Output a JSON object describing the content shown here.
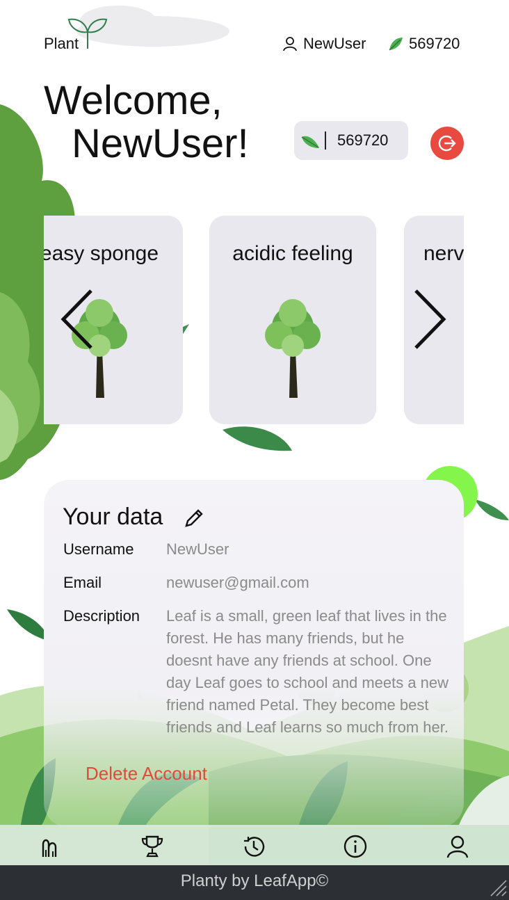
{
  "header": {
    "logo_text": "Plant",
    "username": "NewUser",
    "points": "569720"
  },
  "welcome": {
    "line1": "Welcome,",
    "line2": "NewUser!",
    "points": "569720"
  },
  "carousel": {
    "cards": [
      {
        "title": "easy sponge"
      },
      {
        "title": "acidic feeling"
      },
      {
        "title": "nerv"
      }
    ]
  },
  "profile": {
    "title": "Your data",
    "fields": [
      {
        "label": "Username",
        "value": "NewUser"
      },
      {
        "label": "Email",
        "value": "newuser@gmail.com"
      },
      {
        "label": "Description",
        "value": "Leaf is a small, green leaf that lives in the forest. He has many friends, but he doesnt have any friends at school. One day Leaf goes to school and meets a new friend named Petal. They become best friends and Leaf learns so much from her."
      }
    ],
    "delete_label": "Delete Account"
  },
  "nav": {
    "items": [
      {
        "icon": "plants-icon"
      },
      {
        "icon": "trophy-icon"
      },
      {
        "icon": "history-icon"
      },
      {
        "icon": "info-icon"
      },
      {
        "icon": "profile-icon"
      }
    ]
  },
  "footer": {
    "text": "Planty by LeafApp©"
  },
  "colors": {
    "accent_red": "#e84a3f",
    "panel_bg": "#f1f0f4",
    "leaf_green": "#4caf50"
  }
}
